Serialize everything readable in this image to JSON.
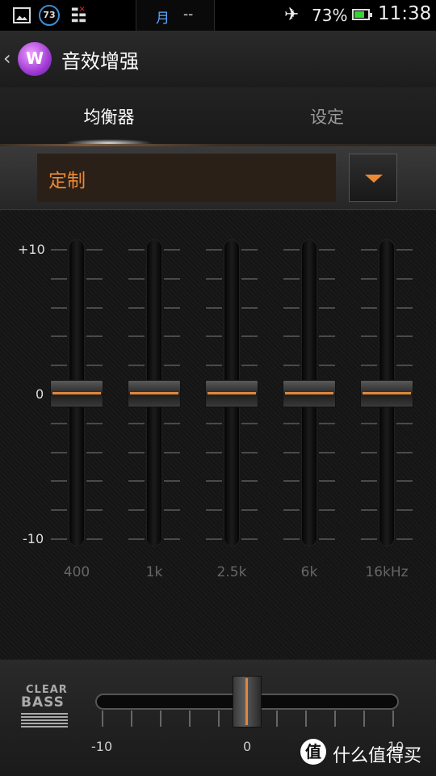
{
  "status_bar": {
    "notification_badge": "73",
    "moon_label": "月",
    "moon_value": "--",
    "battery_percent": "73%",
    "battery_level": 0.73,
    "time": "11:38",
    "icons": [
      "image-icon",
      "count-badge-icon",
      "calendar-icon",
      "airplane-icon",
      "battery-icon"
    ]
  },
  "header": {
    "back_icon": "chevron-left-icon",
    "logo": "W",
    "title": "音效增强"
  },
  "tabs": [
    {
      "label": "均衡器",
      "active": true
    },
    {
      "label": "设定",
      "active": false
    }
  ],
  "preset": {
    "value": "定制",
    "dropdown_icon": "triangle-down-icon"
  },
  "equalizer": {
    "y_labels": {
      "max": "+10",
      "mid": "0",
      "min": "-10"
    },
    "bands": [
      {
        "label": "400",
        "value": 0
      },
      {
        "label": "1k",
        "value": 0
      },
      {
        "label": "2.5k",
        "value": 0
      },
      {
        "label": "6k",
        "value": 0
      },
      {
        "label": "16kHz",
        "value": 0
      }
    ]
  },
  "clear_bass": {
    "logo_top": "CLEAR",
    "logo_bottom": "BASS",
    "min_label": "-10",
    "mid_label": "0",
    "max_label": "10",
    "value": 0
  },
  "watermark": {
    "icon": "值",
    "text": "什么值得买"
  },
  "colors": {
    "accent": "#e0883d",
    "preset_text": "#ea8a35",
    "status_blue": "#5aaaff"
  }
}
